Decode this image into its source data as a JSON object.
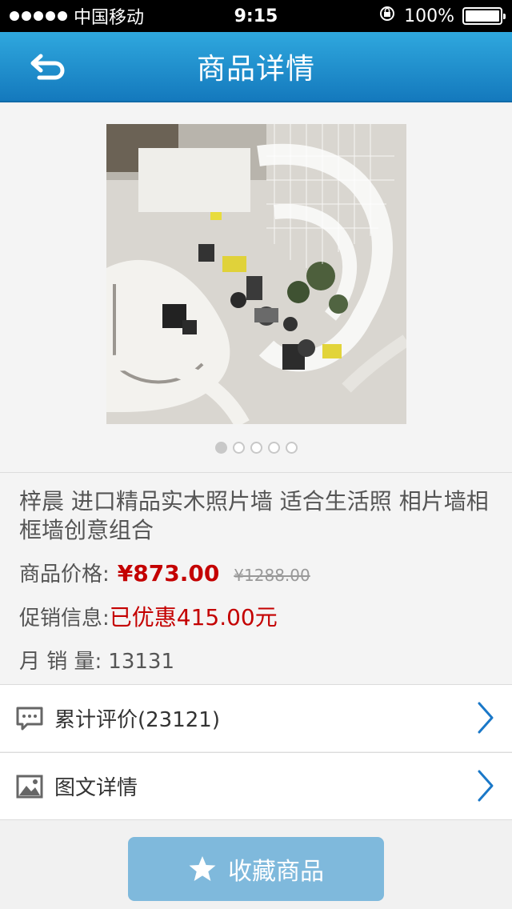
{
  "status_bar": {
    "carrier": "中国移动",
    "time": "9:15",
    "battery": "100%"
  },
  "nav": {
    "title": "商品详情"
  },
  "gallery": {
    "page_count": 5,
    "active_page": 1
  },
  "product": {
    "title": "梓晨 进口精品实木照片墙 适合生活照 相片墙相框墙创意组合",
    "price_label": "商品价格:",
    "price": "¥873.00",
    "original_price": "¥1288.00",
    "promo_label": "促销信息:",
    "promo": "已优惠415.00元",
    "sales_label": "月 销 量:",
    "sales": "13131"
  },
  "list": {
    "reviews_label": "累计评价(23121)",
    "details_label": "图文详情"
  },
  "actions": {
    "favorite_label": "收藏商品"
  },
  "colors": {
    "nav_blue": "#1f8fd0",
    "price_red": "#c40000",
    "button_blue": "#7fb9dc"
  }
}
